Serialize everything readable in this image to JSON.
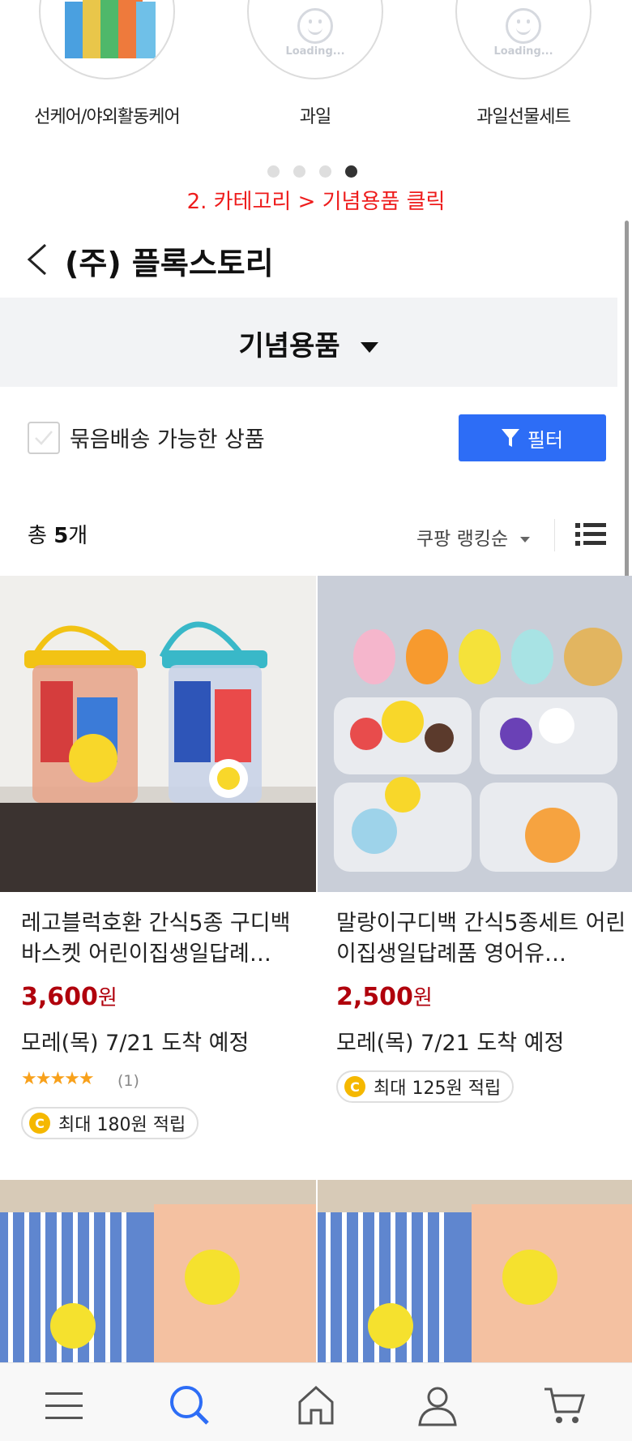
{
  "categories": [
    {
      "label": "선케어/야외활동케어",
      "loading_text": ""
    },
    {
      "label": "과일",
      "loading_text": "Loading..."
    },
    {
      "label": "과일선물세트",
      "loading_text": "Loading..."
    }
  ],
  "carousel": {
    "total_pages": 4,
    "active_index": 3
  },
  "annotation": "2. 카테고리 > 기념용품 클릭",
  "header": {
    "store_name": "(주) 플록스토리"
  },
  "category_bar": {
    "label": "기념용품"
  },
  "bundle_filter": {
    "label": "묶음배송 가능한 상품",
    "checked": false
  },
  "filter_button": {
    "label": "필터"
  },
  "result_count": {
    "prefix": "총 ",
    "number": "5",
    "suffix": "개"
  },
  "sort": {
    "label": "쿠팡 랭킹순"
  },
  "products": [
    {
      "name": "레고블럭호환 간식5종 구디백 바스켓 어린이집생일답례…",
      "price": "3,600",
      "currency": "원",
      "delivery": "모레(목) 7/21 도착 예정",
      "rating_stars": "★★★★★",
      "rating_count": "(1)",
      "reward": "최대 180원 적립"
    },
    {
      "name": "말랑이구디백 간식5종세트 어린이집생일답례품 영어유…",
      "price": "2,500",
      "currency": "원",
      "delivery": "모레(목) 7/21 도착 예정",
      "rating_stars": "",
      "rating_count": "",
      "reward": "최대 125원 적립"
    }
  ],
  "coin_symbol": "C",
  "colors": {
    "accent": "#2d6df6",
    "price": "#b0000c",
    "annotation": "#ee1c1c",
    "star": "#f8a11b"
  },
  "bottom_nav": [
    "menu-icon",
    "search-icon",
    "home-icon",
    "user-icon",
    "cart-icon"
  ]
}
